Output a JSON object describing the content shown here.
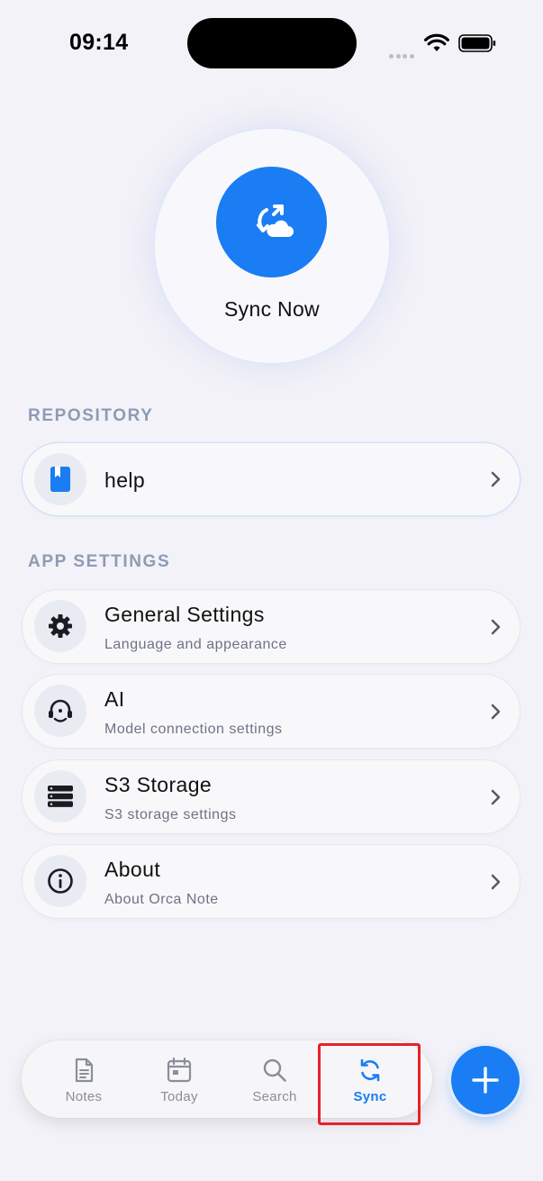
{
  "status_bar": {
    "time": "09:14"
  },
  "hero": {
    "label": "Sync Now",
    "icon": "sync-cloud-icon",
    "color": "#1a7df3"
  },
  "sections": {
    "repository": "REPOSITORY",
    "app_settings": "APP SETTINGS"
  },
  "repository": {
    "name": "help",
    "icon": "book-icon"
  },
  "settings": [
    {
      "title": "General Settings",
      "subtitle": "Language and appearance",
      "icon": "gear-icon"
    },
    {
      "title": "AI",
      "subtitle": "Model connection settings",
      "icon": "ai-headset-icon"
    },
    {
      "title": "S3 Storage",
      "subtitle": "S3 storage settings",
      "icon": "storage-icon"
    },
    {
      "title": "About",
      "subtitle": "About Orca Note",
      "icon": "info-icon"
    }
  ],
  "tabs": [
    {
      "label": "Notes",
      "icon": "notes-icon"
    },
    {
      "label": "Today",
      "icon": "calendar-icon"
    },
    {
      "label": "Search",
      "icon": "search-icon"
    },
    {
      "label": "Sync",
      "icon": "sync-icon",
      "active": true
    }
  ],
  "fab": {
    "icon": "plus-icon"
  },
  "colors": {
    "accent": "#1a7df3",
    "highlight": "#e8212a",
    "section": "#8e9bb3"
  }
}
